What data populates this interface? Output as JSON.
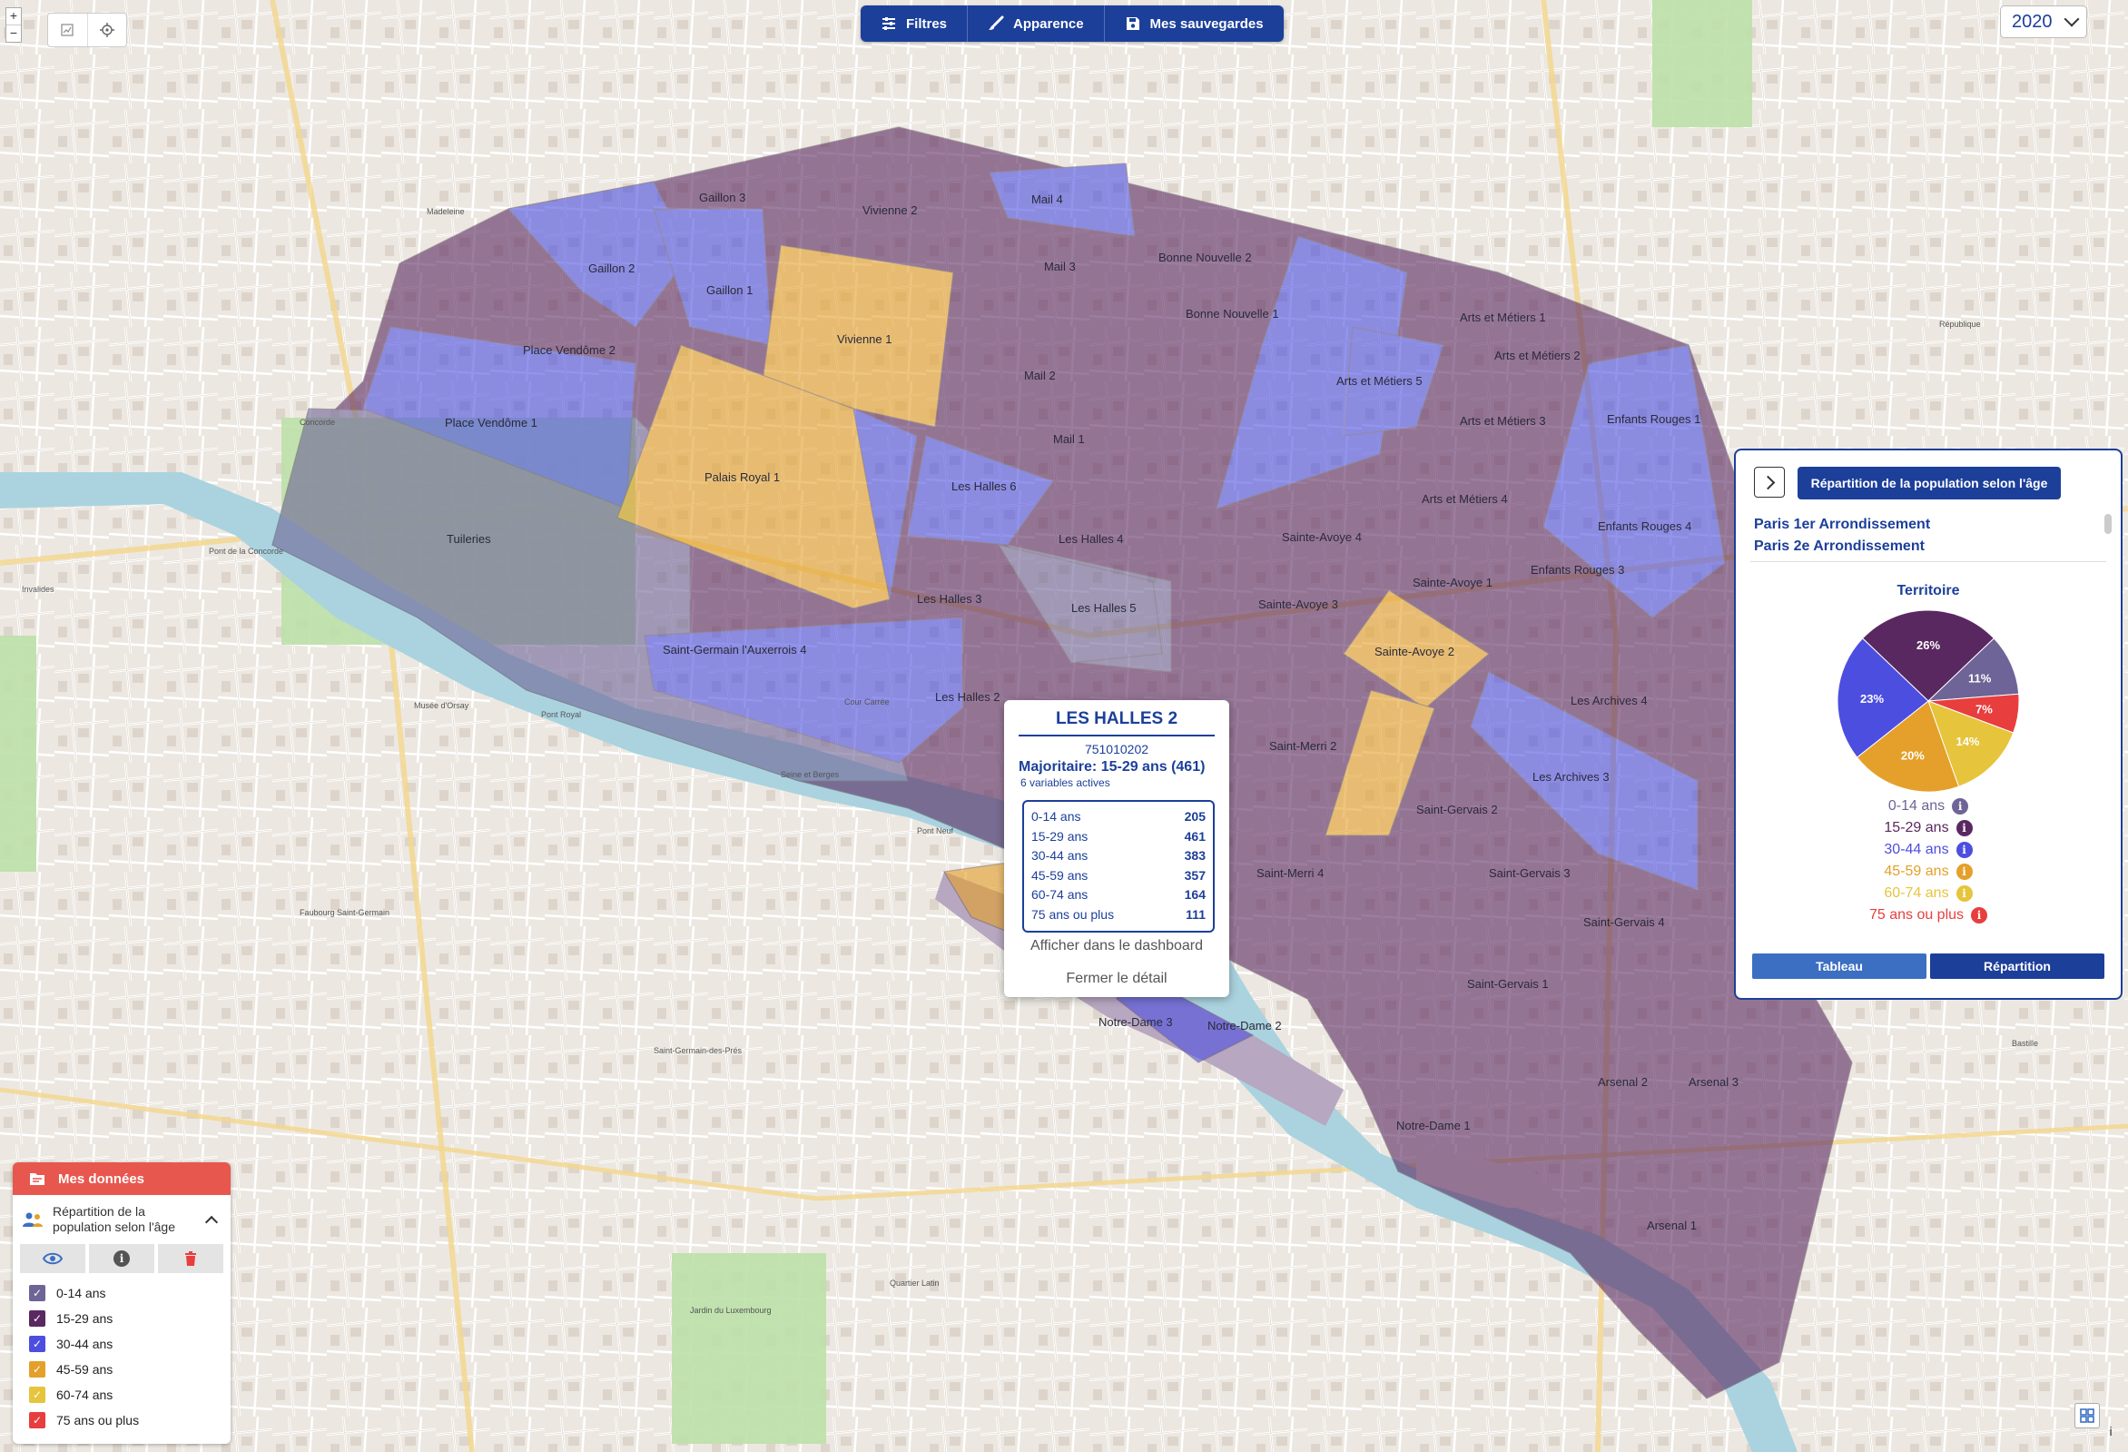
{
  "toolbar": {
    "filters_label": "Filtres",
    "appearance_label": "Apparence",
    "saves_label": "Mes sauvegardes"
  },
  "year_select": {
    "value": "2020"
  },
  "zoom": {
    "in": "+",
    "out": "−"
  },
  "map": {
    "zone_labels": [
      "Gaillon 3",
      "Vivienne 2",
      "Mail 4",
      "Gaillon 2",
      "Gaillon 1",
      "Bonne Nouvelle 2",
      "Mail 3",
      "Place Vendôme 2",
      "Vivienne 1",
      "Bonne Nouvelle 1",
      "Arts et Métiers 1",
      "Arts et Métiers 2",
      "Mail 2",
      "Arts et Métiers 5",
      "Place Vendôme 1",
      "Mail 1",
      "Arts et Métiers 3",
      "Enfants Rouges 1",
      "Palais Royal 1",
      "Les Halles 6",
      "Arts et Métiers 4",
      "Enfants Rouges 4",
      "Tuileries",
      "Les Halles 4",
      "Sainte-Avoye 4",
      "Les Halles 3",
      "Les Halles 5",
      "Sainte-Avoye 3",
      "Sainte-Avoye 1",
      "Enfants Rouges 3",
      "Saint-Germain l'Auxerrois 4",
      "Sainte-Avoye 2",
      "Les Halles 2",
      "Saint-Merri 2",
      "Les Archives 4",
      "Les Archives 3",
      "Saint-Gervais 2",
      "Saint-Merri 4",
      "Saint-Gervais 3",
      "Saint-Gervais 4",
      "Saint-Gervais 1",
      "Notre-Dame 3",
      "Notre-Dame 2",
      "Arsenal 2",
      "Arsenal 3",
      "Notre-Dame 1",
      "Arsenal 1"
    ],
    "street_labels": [
      "Madeleine",
      "Concorde",
      "Pont de la Concorde",
      "Invalides",
      "Seine et Berges",
      "Pont Neuf",
      "Saint-Germain-des-Prés",
      "Jardin du Luxembourg",
      "Quartier Latin",
      "Bastille",
      "République",
      "Faubourg Saint-Germain",
      "Musée d'Orsay",
      "Pont Royal",
      "Cour Carrée"
    ]
  },
  "popup": {
    "title": "LES HALLES 2",
    "code": "751010202",
    "majority": "Majoritaire: 15-29 ans (461)",
    "active": "6 variables actives",
    "rows": [
      {
        "label": "0-14 ans",
        "value": "205"
      },
      {
        "label": "15-29 ans",
        "value": "461"
      },
      {
        "label": "30-44 ans",
        "value": "383"
      },
      {
        "label": "45-59 ans",
        "value": "357"
      },
      {
        "label": "60-74 ans",
        "value": "164"
      },
      {
        "label": "75 ans ou plus",
        "value": "111"
      }
    ],
    "dashboard_link": "Afficher dans le dashboard",
    "close_link": "Fermer le détail"
  },
  "right_panel": {
    "title": "Répartition de la population selon l'âge",
    "territories": [
      "Paris 1er Arrondissement",
      "Paris 2e Arrondissement"
    ],
    "chart_title": "Territoire",
    "tab_table": "Tableau",
    "tab_distribution": "Répartition"
  },
  "legend": [
    {
      "label": "0-14 ans",
      "color": "#6e6497"
    },
    {
      "label": "15-29 ans",
      "color": "#5a2860"
    },
    {
      "label": "30-44 ans",
      "color": "#4c4ee0"
    },
    {
      "label": "45-59 ans",
      "color": "#e4a02a"
    },
    {
      "label": "60-74 ans",
      "color": "#e6c43c"
    },
    {
      "label": "75 ans ou plus",
      "color": "#e83e3e"
    }
  ],
  "data_panel": {
    "header": "Mes données",
    "layer_name": "Répartition de la population selon l'âge"
  },
  "chart_data": {
    "type": "pie",
    "title": "Territoire",
    "categories": [
      "0-14 ans",
      "15-29 ans",
      "30-44 ans",
      "45-59 ans",
      "60-74 ans",
      "75 ans ou plus"
    ],
    "values": [
      11,
      26,
      23,
      20,
      14,
      7
    ],
    "labels": [
      "11%",
      "26%",
      "23%",
      "20%",
      "14%",
      "7%"
    ],
    "colors": [
      "#6e6497",
      "#5a2860",
      "#4c4ee0",
      "#e4a02a",
      "#e6c43c",
      "#e83e3e"
    ]
  },
  "colors": {
    "accent": "#1c3f9a",
    "header_red": "#e8574e"
  }
}
